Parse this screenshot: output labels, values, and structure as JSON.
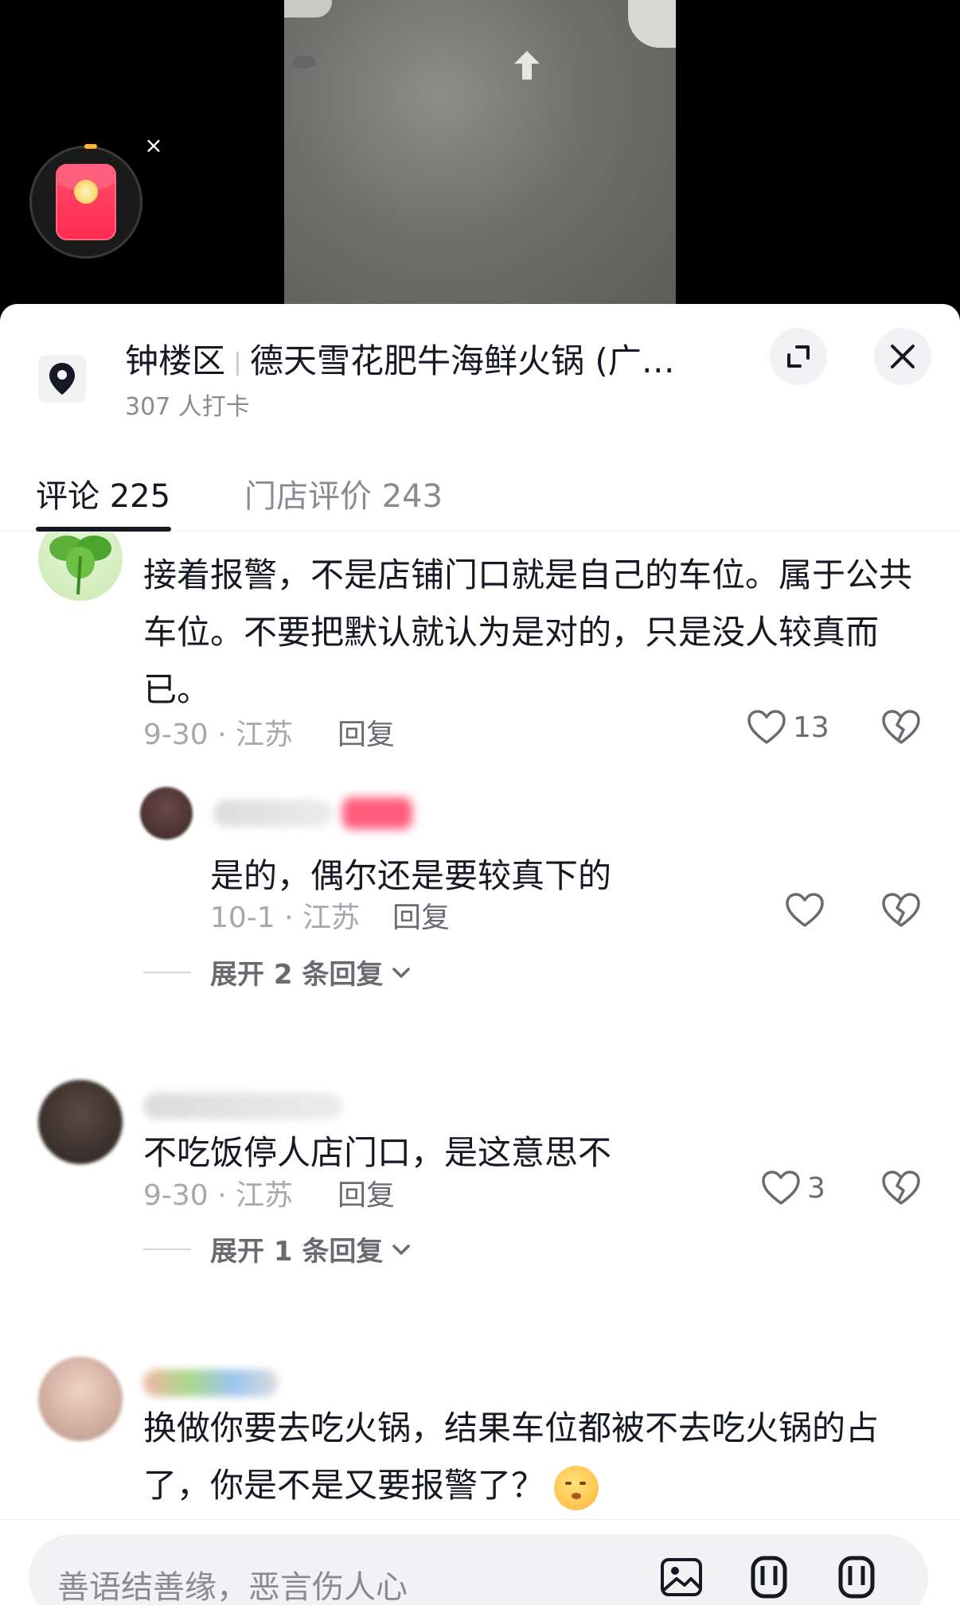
{
  "location": {
    "district": "钟楼区",
    "name": "德天雪花肥牛海鲜火锅 (广…",
    "checkins": "307 人打卡"
  },
  "tabs": [
    {
      "label": "评论 225"
    },
    {
      "label": "门店评价 243"
    }
  ],
  "comments": [
    {
      "text": "接着报警，不是店铺门口就是自己的车位。属于公共车位。不要把默认就认为是对的，只是没人较真而已。",
      "meta": "9-30 · 江苏",
      "reply_label": "回复",
      "likes": "13",
      "sub_reply": {
        "text": "是的，偶尔还是要较真下的",
        "meta": "10-1 · 江苏",
        "reply_label": "回复"
      },
      "expand": "展开 2 条回复"
    },
    {
      "text": "不吃饭停人店门口，是这意思不",
      "meta": "9-30 · 江苏",
      "reply_label": "回复",
      "likes": "3",
      "expand": "展开 1 条回复"
    },
    {
      "text": "换做你要去吃火锅，结果车位都被不去吃火锅的占了，你是不是又要报警了？"
    }
  ],
  "input": {
    "placeholder": "善语结善缘，恶言伤人心"
  },
  "colors": {
    "accent": "#161823",
    "muted": "#8a8b91",
    "panel": "#ffffff",
    "redpack": "#ff2a52"
  },
  "icons": [
    "location-pin-icon",
    "expand-icon",
    "close-icon",
    "heart-icon",
    "broken-heart-icon",
    "image-icon",
    "red-packet-icon"
  ]
}
